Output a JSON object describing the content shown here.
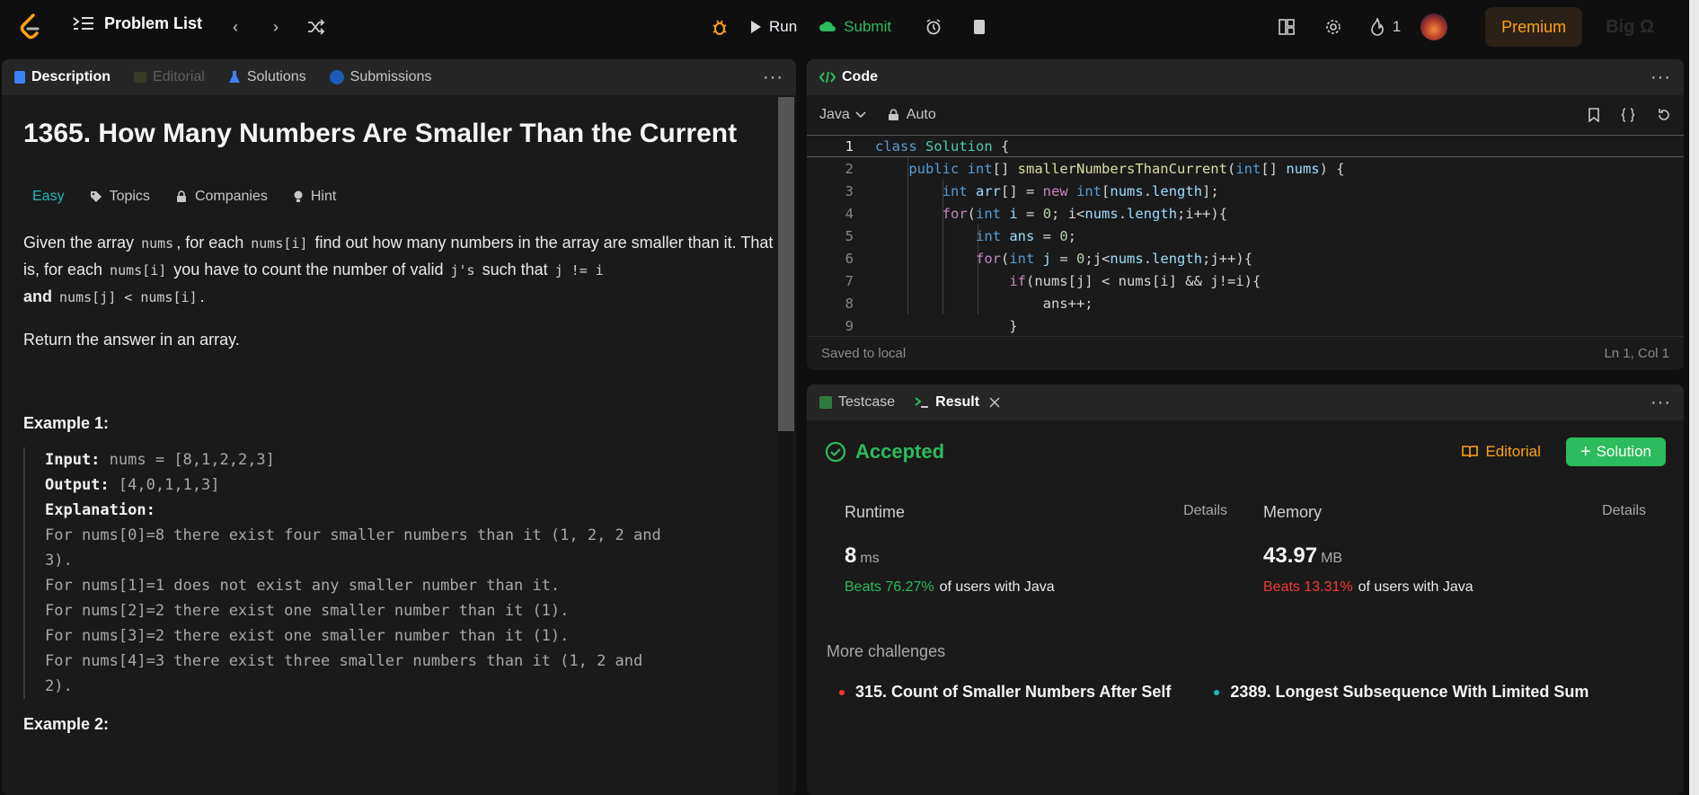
{
  "nav": {
    "problem_list": "Problem List",
    "run": "Run",
    "submit": "Submit",
    "streak": "1",
    "premium": "Premium",
    "big_o": "Big Ω"
  },
  "desc_tabs": {
    "description": "Description",
    "editorial": "Editorial",
    "solutions": "Solutions",
    "submissions": "Submissions"
  },
  "problem": {
    "title": "1365. How Many Numbers Are Smaller Than the Current",
    "difficulty": "Easy",
    "topics": "Topics",
    "companies": "Companies",
    "hint": "Hint",
    "p1": "Given the array ",
    "c_nums": "nums",
    "p2": ", for each ",
    "c_numsi": "nums[i]",
    "p3": " find out how many numbers in the array are smaller than it. That is, for each ",
    "c_numsi2": "nums[i]",
    "p4": " you have to count the number of valid ",
    "c_js": "j's",
    "p5": " such that ",
    "c_jneq": "j != i",
    "p6": "and",
    "c_cond": "nums[j] < nums[i]",
    "p7": ".",
    "return": "Return the answer in an array.",
    "example1_title": "Example 1:",
    "input_label": "Input:",
    "input_value": "nums = [8,1,2,2,3]",
    "output_label": "Output:",
    "output_value": "[4,0,1,1,3]",
    "explanation_label": "Explanation:",
    "exp1": "For nums[0]=8 there exist four smaller numbers than it (1, 2, 2 and",
    "exp1b": "3).",
    "exp2": "For nums[1]=1 does not exist any smaller number than it.",
    "exp3": "For nums[2]=2 there exist one smaller number than it (1).",
    "exp4": "For nums[3]=2 there exist one smaller number than it (1).",
    "exp5": "For nums[4]=3 there exist three smaller numbers than it (1, 2 and",
    "exp5b": "2).",
    "example2_title": "Example 2:"
  },
  "editor": {
    "title": "Code",
    "language": "Java",
    "auto": "Auto",
    "saved": "Saved to local",
    "position": "Ln 1, Col 1",
    "line_numbers": [
      "1",
      "2",
      "3",
      "4",
      "5",
      "6",
      "7",
      "8",
      "9"
    ]
  },
  "result": {
    "tab_testcase": "Testcase",
    "tab_result": "Result",
    "status": "Accepted",
    "editorial": "Editorial",
    "solution": "Solution",
    "runtime_label": "Runtime",
    "runtime_value": "8",
    "runtime_unit": "ms",
    "runtime_beats": "Beats 76.27%",
    "memory_label": "Memory",
    "memory_value": "43.97",
    "memory_unit": "MB",
    "memory_beats": "Beats 13.31%",
    "details": "Details",
    "beats_suffix": "of users with Java",
    "more_challenges": "More challenges",
    "challenge1": "315. Count of Smaller Numbers After Self",
    "challenge2": "2389. Longest Subsequence With Limited Sum"
  }
}
